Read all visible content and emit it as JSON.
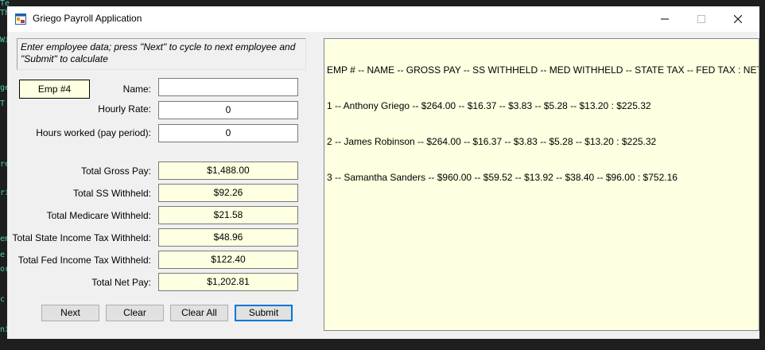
{
  "background_code": [
    "Te",
    "Th",
    "Wi",
    "ge",
    "T",
    "re",
    "ri",
    "emp",
    "e",
    "or",
    "c",
    "ni"
  ],
  "window": {
    "title": "Griego Payroll Application",
    "controls": {
      "minimize": "—",
      "maximize": "☐",
      "close": "✕"
    }
  },
  "form": {
    "instructions": "Enter employee data; press \"Next\" to cycle to next employee and \"Submit\" to calculate",
    "employee_badge": "Emp #4",
    "name_label": "Name:",
    "name_value": "",
    "hourly_rate_label": "Hourly Rate:",
    "hourly_rate_value": "0",
    "hours_worked_label": "Hours worked (pay period):",
    "hours_worked_value": "0"
  },
  "totals": [
    {
      "label": "Total Gross Pay:",
      "value": "$1,488.00"
    },
    {
      "label": "Total SS Withheld:",
      "value": "$92.26"
    },
    {
      "label": "Total Medicare Withheld:",
      "value": "$21.58"
    },
    {
      "label": "Total State Income Tax Withheld:",
      "value": "$48.96"
    },
    {
      "label": "Total Fed Income Tax Withheld:",
      "value": "$122.40"
    },
    {
      "label": "Total Net Pay:",
      "value": "$1,202.81"
    }
  ],
  "buttons": {
    "next": "Next",
    "clear": "Clear",
    "clear_all": "Clear All",
    "submit": "Submit"
  },
  "output": {
    "header": "EMP # -- NAME -- GROSS PAY -- SS WITHHELD -- MED WITHHELD -- STATE TAX -- FED TAX : NET PAY",
    "rows": [
      " 1 -- Anthony Griego -- $264.00 -- $16.37 -- $3.83 -- $5.28 -- $13.20 : $225.32",
      " 2 -- James Robinson -- $264.00 -- $16.37 -- $3.83 -- $5.28 -- $13.20 : $225.32",
      " 3 -- Samantha Sanders -- $960.00 -- $59.52 -- $13.92 -- $38.40 -- $96.00 : $752.16"
    ]
  },
  "colors": {
    "readonly_bg": "#ffffe1",
    "window_bg": "#f0f0f0",
    "default_button_border": "#0078d7",
    "ide_bg": "#1e1e1e"
  }
}
